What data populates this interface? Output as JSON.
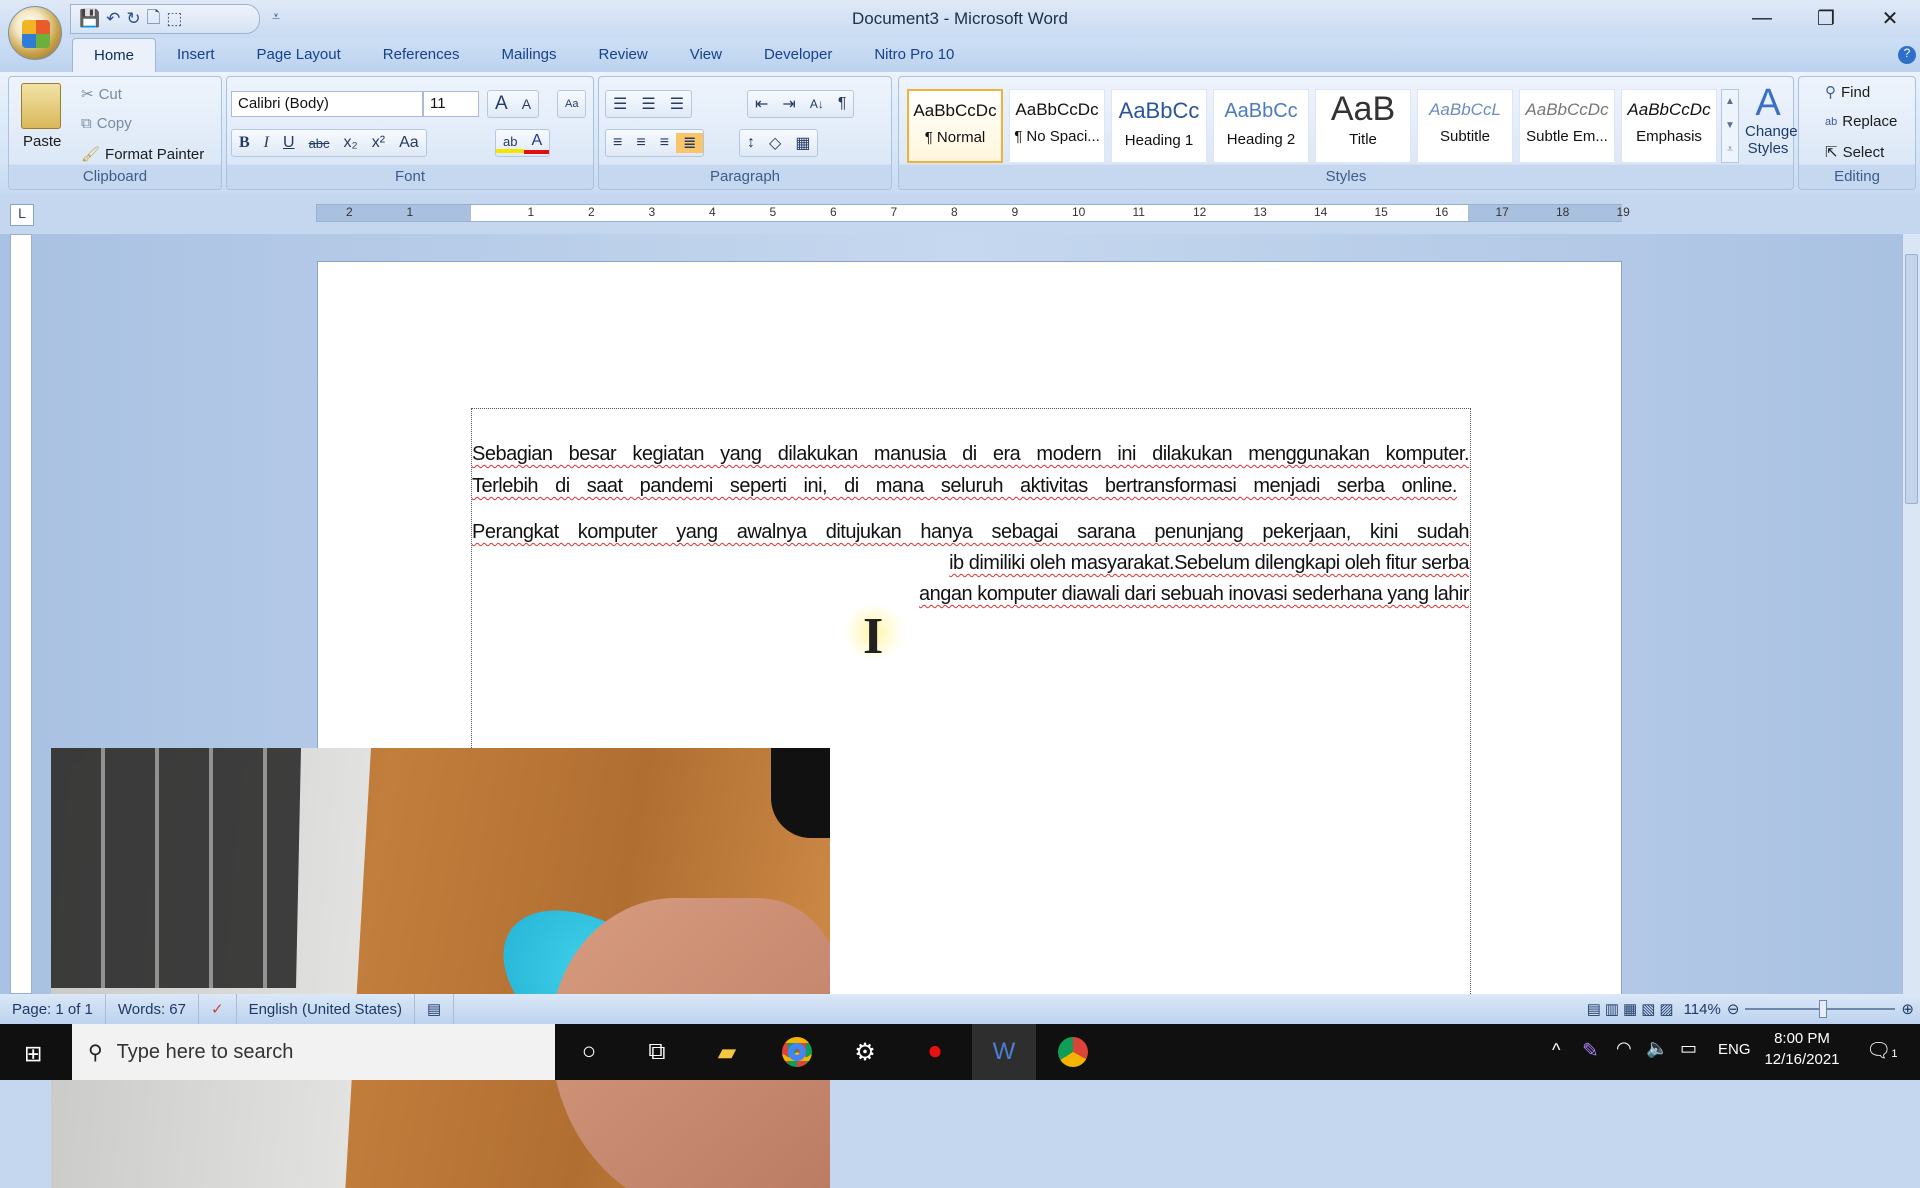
{
  "window": {
    "title": "Document3 - Microsoft Word",
    "minimize": "—",
    "restore": "❐",
    "close": "✕"
  },
  "qat": {
    "save": "💾",
    "undo": "↶",
    "redo": "↻",
    "print_preview": "🗋",
    "more": "⬚",
    "customize": "⩡"
  },
  "tabs": [
    "Home",
    "Insert",
    "Page Layout",
    "References",
    "Mailings",
    "Review",
    "View",
    "Developer",
    "Nitro Pro 10"
  ],
  "clipboard": {
    "label": "Clipboard",
    "paste": "Paste",
    "cut": "Cut",
    "copy": "Copy",
    "format_painter": "Format Painter"
  },
  "font": {
    "label": "Font",
    "name": "Calibri (Body)",
    "size": "11",
    "grow": "A",
    "shrink": "A",
    "clear": "Aa",
    "bold": "B",
    "italic": "I",
    "underline": "U",
    "strike": "abc",
    "subscript": "x₂",
    "superscript": "x²",
    "case": "Aa",
    "highlight": "ab",
    "color": "A"
  },
  "paragraph": {
    "label": "Paragraph",
    "bullets": "☰",
    "numbering": "☰",
    "multilevel": "☰",
    "dec_indent": "⇤",
    "inc_indent": "⇥",
    "sort": "A↓",
    "show_marks": "¶",
    "align_left": "≡",
    "center": "≡",
    "align_right": "≡",
    "justify": "≣",
    "line_spacing": "↕",
    "shading": "◇",
    "borders": "▦"
  },
  "styles": {
    "label": "Styles",
    "items": [
      {
        "preview": "AaBbCcDc",
        "name": "¶ Normal",
        "selected": true
      },
      {
        "preview": "AaBbCcDc",
        "name": "¶ No Spaci..."
      },
      {
        "preview": "AaBbCc",
        "name": "Heading 1"
      },
      {
        "preview": "AaBbCc",
        "name": "Heading 2"
      },
      {
        "preview": "AaB",
        "name": "Title"
      },
      {
        "preview": "AaBbCcL",
        "name": "Subtitle"
      },
      {
        "preview": "AaBbCcDc",
        "name": "Subtle Em..."
      },
      {
        "preview": "AaBbCcDc",
        "name": "Emphasis"
      }
    ],
    "change_styles": "Change Styles"
  },
  "editing": {
    "label": "Editing",
    "find": "Find",
    "replace": "Replace",
    "select": "Select"
  },
  "ruler": {
    "ticks": [
      "2",
      "1",
      "1",
      "2",
      "3",
      "4",
      "5",
      "6",
      "7",
      "8",
      "9",
      "10",
      "11",
      "12",
      "13",
      "14",
      "15",
      "16",
      "17",
      "18",
      "19"
    ]
  },
  "document": {
    "lines": [
      "Sebagian besar kegiatan yang dilakukan manusia di era modern ini dilakukan menggunakan komputer.",
      "Terlebih di saat pandemi seperti ini, di mana seluruh aktivitas  bertransformasi menjadi serba online.",
      "Perangkat komputer yang awalnya ditujukan hanya sebagai sarana penunjang pekerjaan, kini sudah",
      "ib dimiliki oleh masyarakat.Sebelum dilengkapi oleh fitur serba",
      "angan komputer diawali dari sebuah inovasi sederhana yang lahir"
    ]
  },
  "status": {
    "page": "Page: 1 of 1",
    "words": "Words: 67",
    "language": "English (United States)",
    "zoom": "114%",
    "zoom_level_percent": 114
  },
  "taskbar": {
    "search_placeholder": "Type here to search",
    "language": "ENG",
    "time": "8:00 PM",
    "date": "12/16/2021",
    "notifications": "1"
  }
}
